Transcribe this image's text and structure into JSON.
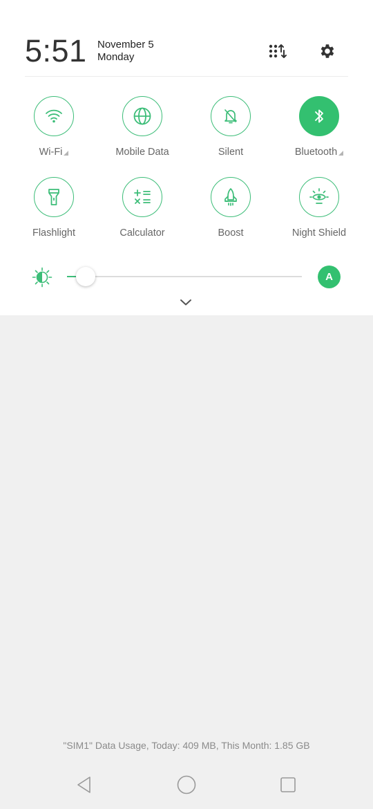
{
  "header": {
    "time": "5:51",
    "date": "November 5",
    "weekday": "Monday",
    "edit_icon": "edit-tiles-icon",
    "settings_icon": "gear-icon"
  },
  "tiles": [
    {
      "label": "Wi-Fi",
      "icon": "wifi-icon",
      "active": false,
      "has_menu": true
    },
    {
      "label": "Mobile Data",
      "icon": "globe-icon",
      "active": false,
      "has_menu": false
    },
    {
      "label": "Silent",
      "icon": "bell-off-icon",
      "active": false,
      "has_menu": false
    },
    {
      "label": "Bluetooth",
      "icon": "bluetooth-icon",
      "active": true,
      "has_menu": true
    },
    {
      "label": "Flashlight",
      "icon": "flashlight-icon",
      "active": false,
      "has_menu": false
    },
    {
      "label": "Calculator",
      "icon": "calculator-icon",
      "active": false,
      "has_menu": false
    },
    {
      "label": "Boost",
      "icon": "rocket-icon",
      "active": false,
      "has_menu": false
    },
    {
      "label": "Night Shield",
      "icon": "eye-icon",
      "active": false,
      "has_menu": false
    }
  ],
  "brightness": {
    "icon": "brightness-icon",
    "level": 0.08,
    "auto_label": "A"
  },
  "expand_icon": "chevron-down-icon",
  "data_usage": "\"SIM1\" Data Usage, Today: 409 MB, This Month: 1.85 GB",
  "navbar": {
    "back_icon": "back-icon",
    "home_icon": "home-icon",
    "recents_icon": "recents-icon"
  },
  "colors": {
    "accent": "#33c070",
    "background": "#f0f0f0",
    "panel": "#ffffff"
  }
}
